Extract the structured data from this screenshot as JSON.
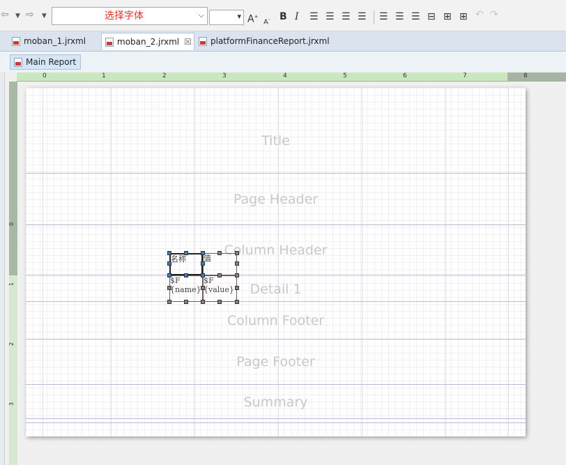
{
  "toolbar": {
    "font_value": "选择字体",
    "font_size_value": "",
    "grow_label": "A",
    "shrink_label": "A",
    "bold_label": "B",
    "italic_label": "I"
  },
  "tabs": [
    {
      "label": "moban_1.jrxml",
      "active": false
    },
    {
      "label": "moban_2.jrxml",
      "active": true,
      "close": "☒"
    },
    {
      "label": "platformFinanceReport.jrxml",
      "active": false
    }
  ],
  "report": {
    "main_report_label": "Main Report"
  },
  "ruler": {
    "h_numbers": [
      "0",
      "1",
      "2",
      "3",
      "4",
      "5",
      "6",
      "7",
      "8"
    ],
    "v_numbers": [
      "0",
      "1",
      "2",
      "3"
    ]
  },
  "bands": {
    "title": "Title",
    "page_header": "Page Header",
    "column_header": "Column Header",
    "detail": "Detail 1",
    "column_footer": "Column Footer",
    "page_footer": "Page Footer",
    "summary": "Summary"
  },
  "fields": {
    "header_name": "名称",
    "header_value": "值",
    "detail_name_prefix": "$F",
    "detail_name": "{name}",
    "detail_value_prefix": "$F",
    "detail_value": "{value}"
  },
  "colors": {
    "accent_font": "#e2312d",
    "handle_selected": "#3e7db6"
  }
}
